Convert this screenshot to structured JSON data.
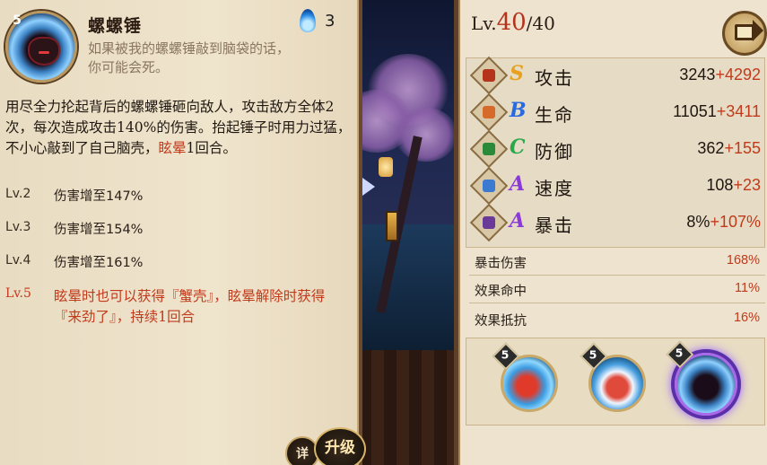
{
  "skill": {
    "level": "5",
    "name": "螺螺锤",
    "cost": "3",
    "quote_line1": "如果被我的螺螺锤敲到脑袋的话，",
    "quote_line2": "你可能会死。",
    "desc_part1": "用尽全力抡起背后的螺螺锤砸向敌人，攻击敌方全体2次，每次造成攻击140%的伤害。抬起锤子时用力过猛，不小心敲到了自己脑壳，",
    "desc_highlight": "眩晕",
    "desc_part2": "1回合。",
    "upgrades": [
      {
        "lv": "Lv.2",
        "text": "伤害增至147%"
      },
      {
        "lv": "Lv.3",
        "text": "伤害增至154%"
      },
      {
        "lv": "Lv.4",
        "text": "伤害增至161%"
      },
      {
        "lv": "Lv.5",
        "text": "眩晕时也可以获得『蟹壳』，眩晕解除时获得『来劲了』，持续1回合"
      }
    ],
    "detail_button": "详",
    "upgrade_button": "升级"
  },
  "stats_panel": {
    "level_prefix": "Lv.",
    "level_current": "40",
    "level_max": "/40",
    "stats": [
      {
        "icon": "attack-icon",
        "grade": "S",
        "grade_color": "#e8a020",
        "name": "攻击",
        "base": "3243",
        "bonus": "+4292",
        "icon_color": "#b5331a"
      },
      {
        "icon": "health-icon",
        "grade": "B",
        "grade_color": "#2a6ae0",
        "name": "生命",
        "base": "11051",
        "bonus": "+3411",
        "icon_color": "#d66a2a"
      },
      {
        "icon": "defense-icon",
        "grade": "C",
        "grade_color": "#2aa84a",
        "name": "防御",
        "base": "362",
        "bonus": "+155",
        "icon_color": "#2a8a3a"
      },
      {
        "icon": "speed-icon",
        "grade": "A",
        "grade_color": "#8a3ad8",
        "name": "速度",
        "base": "108",
        "bonus": "+23",
        "icon_color": "#3a7ad0"
      },
      {
        "icon": "crit-icon",
        "grade": "A",
        "grade_color": "#8a3ad8",
        "name": "暴击",
        "base": "8%",
        "bonus": "+107%",
        "icon_color": "#6a3a98"
      }
    ],
    "sub_stats": [
      {
        "name": "暴击伤害",
        "value": "168%"
      },
      {
        "name": "效果命中",
        "value": "11%"
      },
      {
        "name": "效果抵抗",
        "value": "16%"
      }
    ],
    "skill_slots": [
      {
        "level": "5",
        "icon": "red-claw-skill-icon"
      },
      {
        "level": "5",
        "icon": "crab-skill-icon"
      },
      {
        "level": "5",
        "icon": "hammer-skill-icon"
      }
    ]
  }
}
